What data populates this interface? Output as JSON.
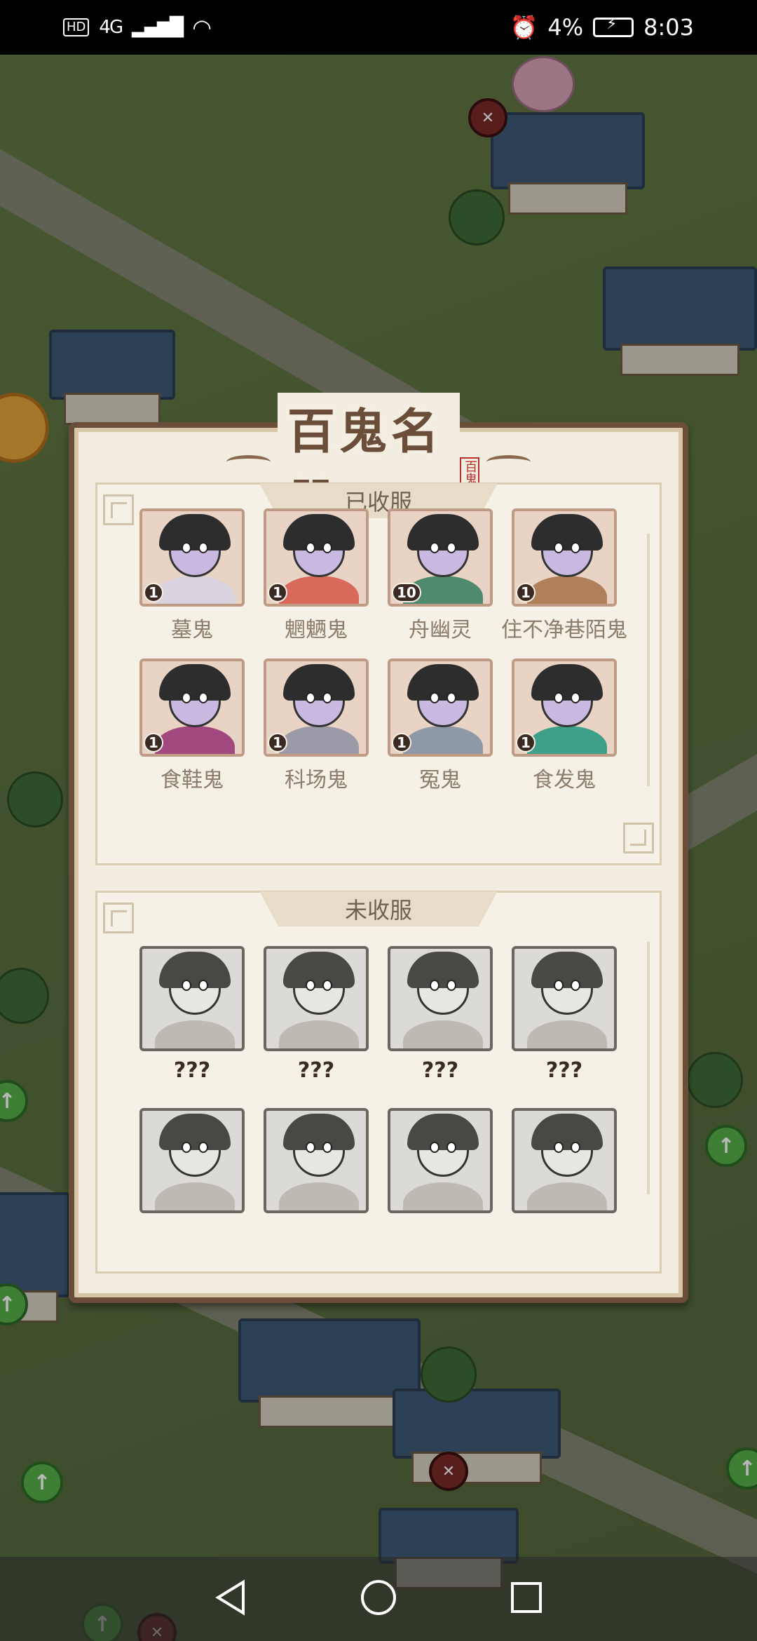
{
  "status_bar": {
    "hd": "HD",
    "network": "4G",
    "battery_percent": "4%",
    "time": "8:03"
  },
  "panel": {
    "title": "百鬼名册",
    "seal": "百鬼"
  },
  "captured": {
    "header": "已收服",
    "items": [
      {
        "name": "墓鬼",
        "level": "1",
        "color": "#d8d3de"
      },
      {
        "name": "魍魉鬼",
        "level": "1",
        "color": "#d9695a"
      },
      {
        "name": "舟幽灵",
        "level": "10",
        "color": "#4f8a6f"
      },
      {
        "name": "住不净巷陌鬼",
        "level": "1",
        "color": "#b0805a"
      },
      {
        "name": "食鞋鬼",
        "level": "1",
        "color": "#a1487e"
      },
      {
        "name": "科场鬼",
        "level": "1",
        "color": "#9d9aa8"
      },
      {
        "name": "冤鬼",
        "level": "1",
        "color": "#8f98a6"
      },
      {
        "name": "食发鬼",
        "level": "1",
        "color": "#3fa08a"
      }
    ]
  },
  "uncaptured": {
    "header": "未收服",
    "items": [
      {
        "name": "???"
      },
      {
        "name": "???"
      },
      {
        "name": "???"
      },
      {
        "name": "???"
      },
      {
        "name": "???"
      },
      {
        "name": "???"
      },
      {
        "name": "???"
      },
      {
        "name": "???"
      }
    ]
  }
}
